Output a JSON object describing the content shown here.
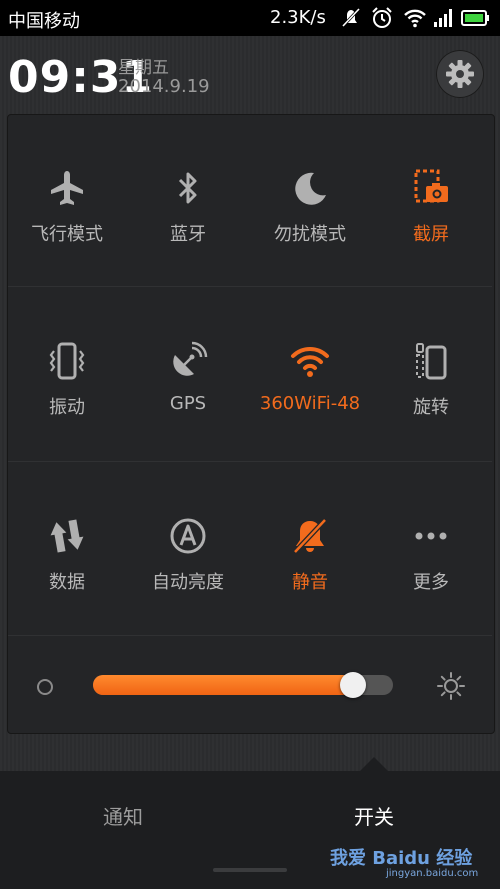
{
  "status_bar": {
    "carrier": "中国移动",
    "net_speed": "2.3K/s",
    "icons": [
      "mute-icon",
      "alarm-icon",
      "wifi-icon",
      "signal-icon",
      "battery-icon"
    ]
  },
  "header": {
    "time": "09:31",
    "weekday": "星期五",
    "date": "2014.9.19",
    "settings_icon": "gear-icon"
  },
  "toggles": [
    {
      "label": "飞行模式",
      "icon": "airplane-icon",
      "active": false
    },
    {
      "label": "蓝牙",
      "icon": "bluetooth-icon",
      "active": false
    },
    {
      "label": "勿扰模式",
      "icon": "moon-icon",
      "active": false
    },
    {
      "label": "截屏",
      "icon": "screenshot-icon",
      "active": true
    },
    {
      "label": "振动",
      "icon": "vibrate-icon",
      "active": false
    },
    {
      "label": "GPS",
      "icon": "gps-icon",
      "active": false
    },
    {
      "label": "360WiFi-48",
      "icon": "wifi-icon",
      "active": true
    },
    {
      "label": "旋转",
      "icon": "rotate-icon",
      "active": false
    },
    {
      "label": "数据",
      "icon": "data-icon",
      "active": false
    },
    {
      "label": "自动亮度",
      "icon": "auto-brightness-icon",
      "active": false
    },
    {
      "label": "静音",
      "icon": "mute-icon",
      "active": true
    },
    {
      "label": "更多",
      "icon": "more-icon",
      "active": false
    }
  ],
  "brightness": {
    "level": 0.9,
    "accent": "#f26b1d"
  },
  "tabs": [
    {
      "label": "通知",
      "active": false
    },
    {
      "label": "开关",
      "active": true
    }
  ],
  "watermark": {
    "brand": "我爱 Baidu 经验",
    "url": "jingyan.baidu.com"
  },
  "colors": {
    "accent": "#f26b1d",
    "inactive_icon": "#b0b0b0",
    "background": "#2b2c2e"
  }
}
